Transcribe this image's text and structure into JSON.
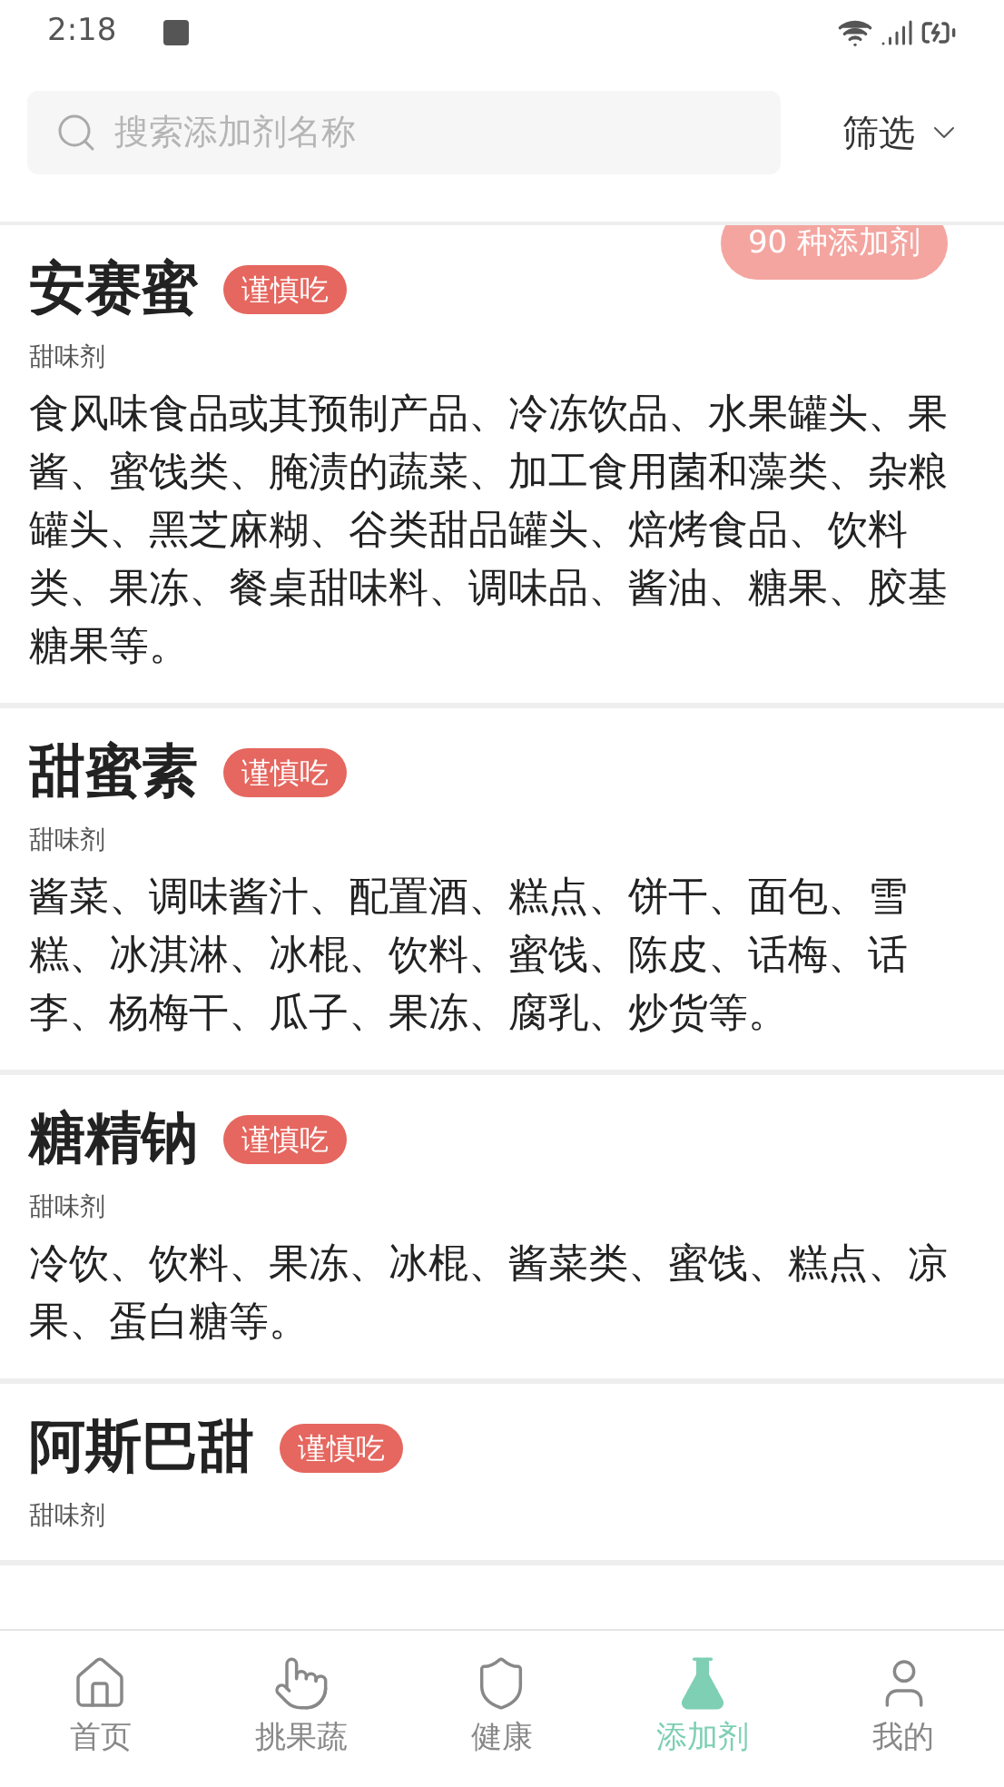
{
  "status_bar": {
    "time": "2:18"
  },
  "search": {
    "placeholder": "搜索添加剂名称"
  },
  "filter": {
    "label": "筛选"
  },
  "count_badge": "90 种添加剂",
  "items": [
    {
      "name": "安赛蜜",
      "tag": "谨慎吃",
      "category": "甜味剂",
      "description": "食风味食品或其预制产品、冷冻饮品、水果罐头、果酱、蜜饯类、腌渍的蔬菜、加工食用菌和藻类、杂粮罐头、黑芝麻糊、谷类甜品罐头、焙烤食品、饮料类、果冻、餐桌甜味料、调味品、酱油、糖果、胶基糖果等。"
    },
    {
      "name": "甜蜜素",
      "tag": "谨慎吃",
      "category": "甜味剂",
      "description": "酱菜、调味酱汁、配置酒、糕点、饼干、面包、雪糕、冰淇淋、冰棍、饮料、蜜饯、陈皮、话梅、话李、杨梅干、瓜子、果冻、腐乳、炒货等。"
    },
    {
      "name": "糖精钠",
      "tag": "谨慎吃",
      "category": "甜味剂",
      "description": "冷饮、饮料、果冻、冰棍、酱菜类、蜜饯、糕点、凉果、蛋白糖等。"
    },
    {
      "name": "阿斯巴甜",
      "tag": "谨慎吃",
      "category": "甜味剂"
    }
  ],
  "tabs": [
    {
      "kind": "home",
      "label": "首页",
      "selected": false
    },
    {
      "kind": "hand",
      "label": "挑果蔬",
      "selected": false
    },
    {
      "kind": "shield",
      "label": "健康",
      "selected": false
    },
    {
      "kind": "flask",
      "label": "添加剂",
      "selected": true
    },
    {
      "kind": "person",
      "label": "我的",
      "selected": false
    }
  ]
}
